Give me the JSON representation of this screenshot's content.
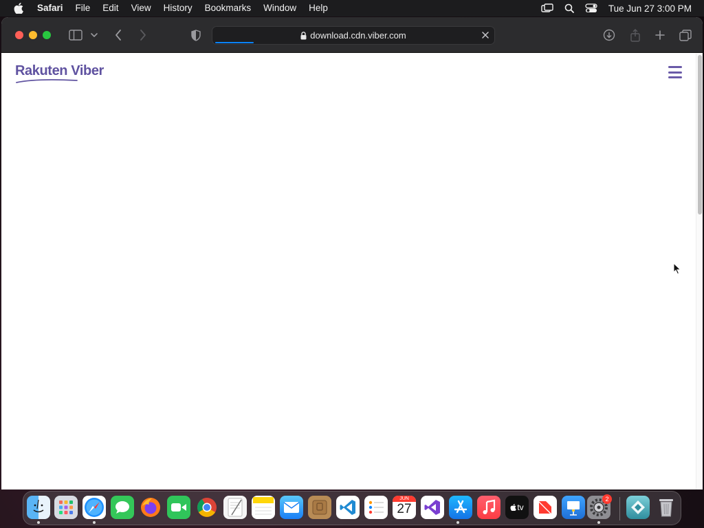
{
  "menubar": {
    "app_name": "Safari",
    "items": [
      "File",
      "Edit",
      "View",
      "History",
      "Bookmarks",
      "Window",
      "Help"
    ],
    "clock": "Tue Jun 27  3:00 PM"
  },
  "browser": {
    "url": "download.cdn.viber.com",
    "loading_progress": 0.14
  },
  "page": {
    "logo_text": "Rakuten Viber",
    "brand_color": "#5f52a0"
  },
  "dock": {
    "calendar_month": "JUN",
    "calendar_day": "27",
    "tv_label": "tv",
    "settings_badge": "2",
    "apps": [
      "Finder",
      "Launchpad",
      "Safari",
      "Messages",
      "Firefox",
      "FaceTime",
      "Chrome",
      "TextEdit",
      "Notes",
      "Mail",
      "Archive",
      "VS Code",
      "Reminders",
      "Calendar",
      "Visual Studio",
      "App Store",
      "Music",
      "Apple TV",
      "News",
      "Keynote",
      "System Settings",
      "Viber Installer",
      "Trash"
    ]
  }
}
